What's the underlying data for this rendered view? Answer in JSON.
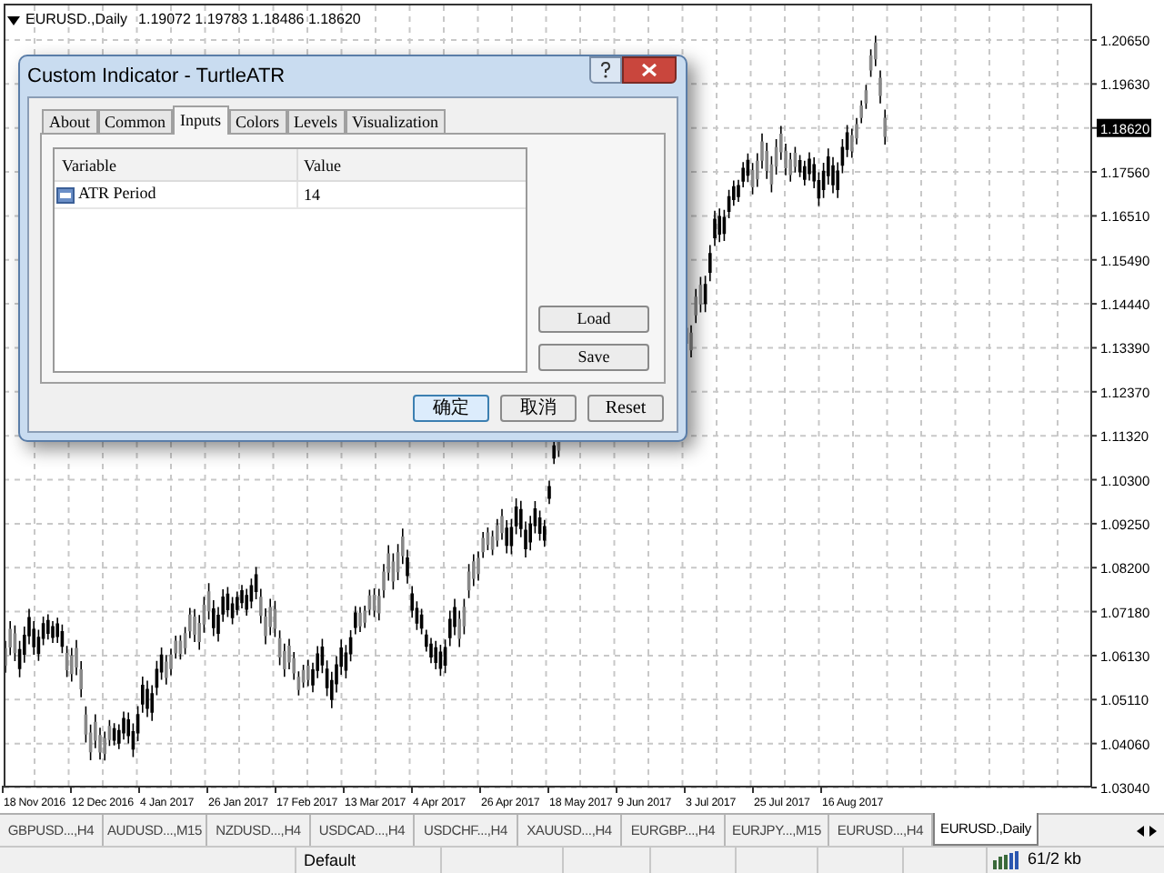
{
  "chart": {
    "symbol": "EURUSD.,Daily",
    "ohlc": "1.19072 1.19783 1.18486 1.18620",
    "price_axis": [
      {
        "label": "1.20650",
        "current": false
      },
      {
        "label": "1.19630",
        "current": false
      },
      {
        "label": "1.18620",
        "current": true
      },
      {
        "label": "1.17560",
        "current": false
      },
      {
        "label": "1.16510",
        "current": false
      },
      {
        "label": "1.15490",
        "current": false
      },
      {
        "label": "1.14440",
        "current": false
      },
      {
        "label": "1.13390",
        "current": false
      },
      {
        "label": "1.12370",
        "current": false
      },
      {
        "label": "1.11320",
        "current": false
      },
      {
        "label": "1.10300",
        "current": false
      },
      {
        "label": "1.09250",
        "current": false
      },
      {
        "label": "1.08200",
        "current": false
      },
      {
        "label": "1.07180",
        "current": false
      },
      {
        "label": "1.06130",
        "current": false
      },
      {
        "label": "1.05110",
        "current": false
      },
      {
        "label": "1.04060",
        "current": false
      },
      {
        "label": "1.03040",
        "current": false
      }
    ],
    "time_axis": [
      "18 Nov 2016",
      "12 Dec 2016",
      "4 Jan 2017",
      "26 Jan 2017",
      "17 Feb 2017",
      "13 Mar 2017",
      "4 Apr 2017",
      "26 Apr 2017",
      "18 May 2017",
      "9 Jun 2017",
      "3 Jul 2017",
      "25 Jul 2017",
      "16 Aug 2017"
    ]
  },
  "dialog": {
    "title": "Custom Indicator - TurtleATR",
    "tabs": [
      {
        "label": "About",
        "selected": false
      },
      {
        "label": "Common",
        "selected": false
      },
      {
        "label": "Inputs",
        "selected": true
      },
      {
        "label": "Colors",
        "selected": false
      },
      {
        "label": "Levels",
        "selected": false
      },
      {
        "label": "Visualization",
        "selected": false
      }
    ],
    "table": {
      "columns": [
        "Variable",
        "Value"
      ],
      "rows": [
        {
          "variable": "ATR Period",
          "value": "14"
        }
      ]
    },
    "side_buttons": [
      "Load",
      "Save"
    ],
    "buttons": [
      {
        "label": "确定",
        "default": true
      },
      {
        "label": "取消",
        "default": false
      },
      {
        "label": "Reset",
        "default": false
      }
    ]
  },
  "symbol_tabs": [
    {
      "label": "GBPUSD...,H4",
      "selected": false
    },
    {
      "label": "AUDUSD...,M15",
      "selected": false
    },
    {
      "label": "NZDUSD...,H4",
      "selected": false
    },
    {
      "label": "USDCAD...,H4",
      "selected": false
    },
    {
      "label": "USDCHF...,H4",
      "selected": false
    },
    {
      "label": "XAUUSD...,H4",
      "selected": false
    },
    {
      "label": "EURGBP...,H4",
      "selected": false
    },
    {
      "label": "EURJPY...,M15",
      "selected": false
    },
    {
      "label": "EURUSD...,H4",
      "selected": false
    },
    {
      "label": "EURUSD.,Daily",
      "selected": true
    }
  ],
  "status_bar": {
    "profile": "Default",
    "traffic": "61/2 kb"
  }
}
